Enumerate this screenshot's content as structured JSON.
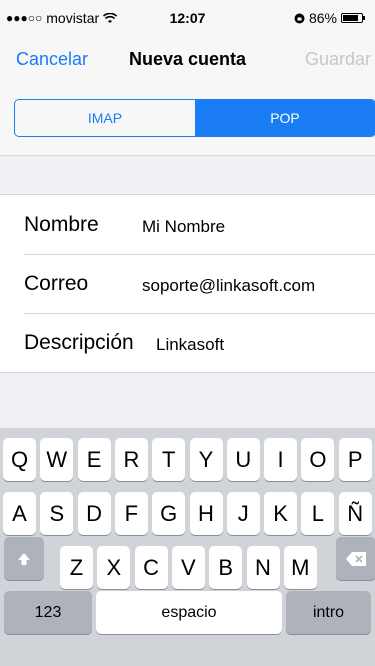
{
  "status_bar": {
    "carrier": "movistar",
    "time": "12:07",
    "battery": "86%",
    "battery_level": 0.86
  },
  "nav": {
    "cancel_label": "Cancelar",
    "title": "Nueva cuenta",
    "save_label": "Guardar"
  },
  "segmented": {
    "options": [
      "IMAP",
      "POP"
    ],
    "selected": "POP"
  },
  "form": {
    "rows": [
      {
        "label": "Nombre",
        "value": "Mi Nombre"
      },
      {
        "label": "Correo",
        "value": "soporte@linkasoft.com"
      },
      {
        "label": "Descripción",
        "value": "Linkasoft"
      }
    ]
  },
  "keyboard": {
    "row1": [
      "Q",
      "W",
      "E",
      "R",
      "T",
      "Y",
      "U",
      "I",
      "O",
      "P"
    ],
    "row2": [
      "A",
      "S",
      "D",
      "F",
      "G",
      "H",
      "J",
      "K",
      "L",
      "Ñ"
    ],
    "row3": [
      "Z",
      "X",
      "C",
      "V",
      "B",
      "N",
      "M"
    ],
    "numbers_label": "123",
    "space_label": "espacio",
    "return_label": "intro",
    "shift_icon": "shift-icon",
    "delete_icon": "delete-icon"
  },
  "colors": {
    "accent": "#1a7df5",
    "disabled": "#c7c7cc"
  }
}
